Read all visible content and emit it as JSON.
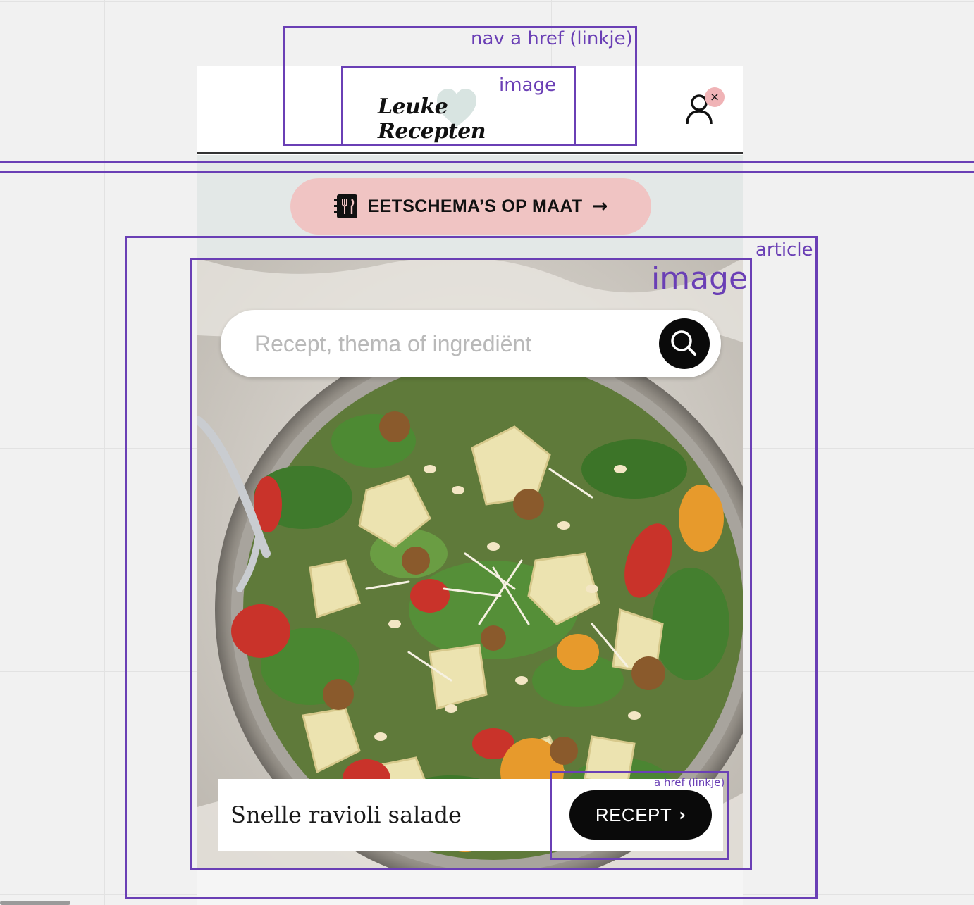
{
  "header": {
    "logo_text": "Leuke Recepten",
    "account_badge": "×"
  },
  "banner": {
    "cta_label": "EETSCHEMA’S OP MAAT",
    "cta_arrow": "→"
  },
  "search": {
    "placeholder": "Recept, thema of ingrediënt"
  },
  "article": {
    "title": "Snelle ravioli salade",
    "button_label": "RECEPT",
    "button_chevron": "›"
  },
  "annotations": {
    "nav_link": "nav a href (linkje)",
    "logo_image": "image",
    "article": "article",
    "hero_image": "image",
    "recept_link": "a href (linkje)"
  },
  "colors": {
    "annotation": "#6a3fb5",
    "cta_background": "#f0c4c3",
    "banner_background": "#e3e8e7",
    "button_black": "#0a0a0a",
    "badge_pink": "#f0b3b6"
  },
  "icons": [
    "heart-icon",
    "user-icon",
    "close-icon",
    "meal-planner-icon",
    "arrow-right-icon",
    "search-icon",
    "chevron-right-icon"
  ]
}
